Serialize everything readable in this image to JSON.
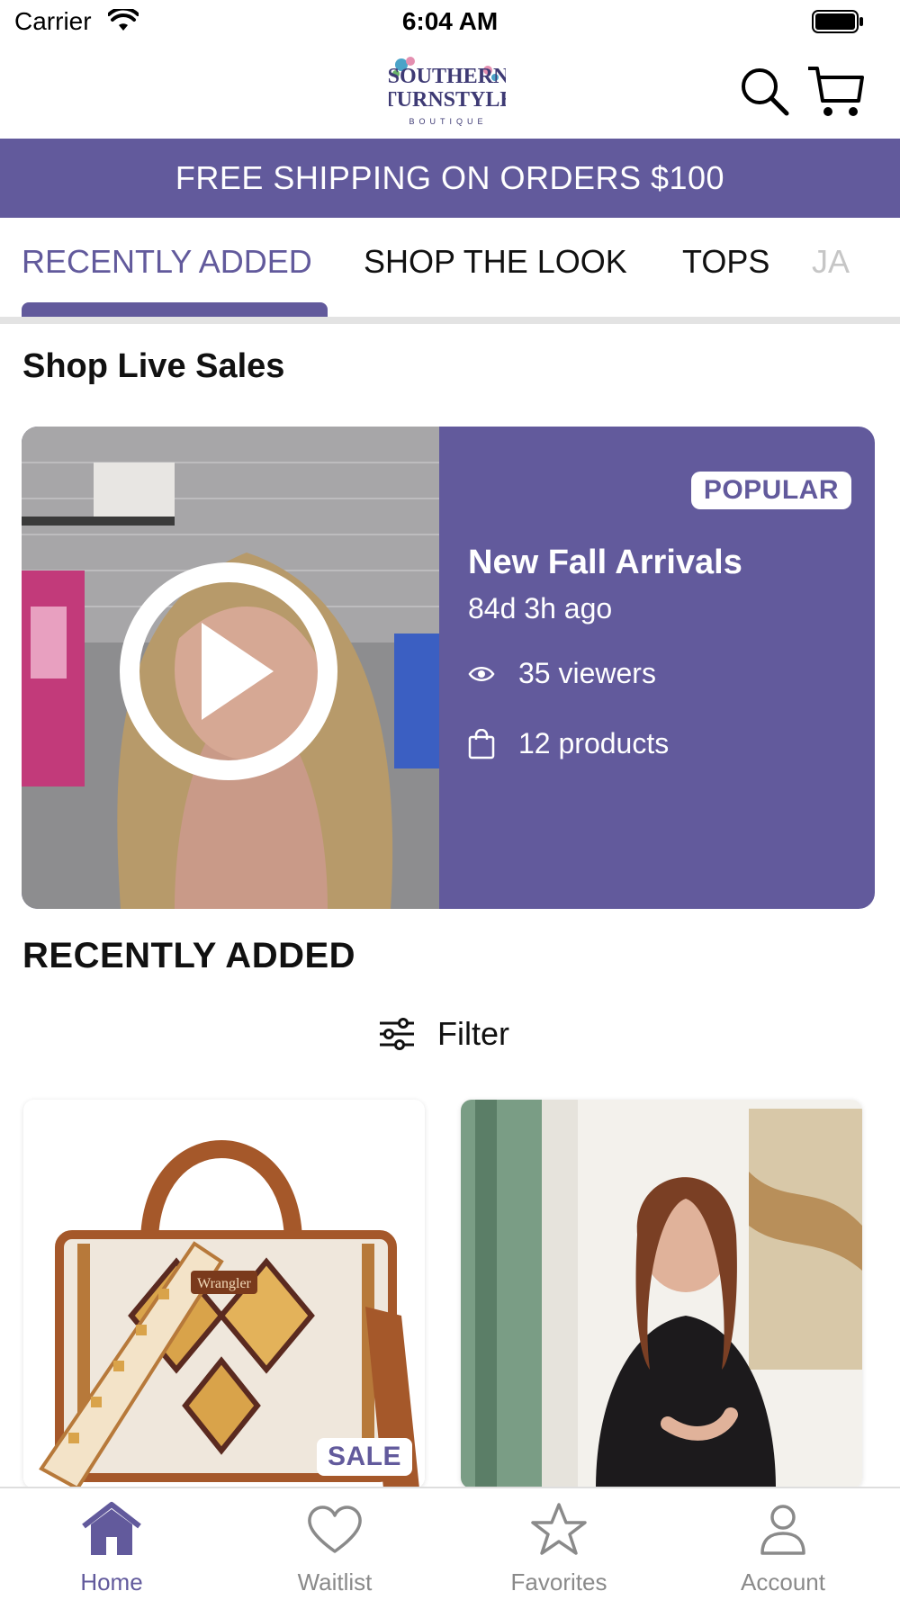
{
  "status_bar": {
    "carrier": "Carrier",
    "time": "6:04 AM"
  },
  "header": {
    "logo_line1": "SOUTHERN",
    "logo_line2": "TURNSTYLE",
    "logo_line3": "BOUTIQUE",
    "icons": [
      "search-icon",
      "cart-icon"
    ]
  },
  "promo": {
    "text": "FREE SHIPPING ON ORDERS $100"
  },
  "tabs": [
    {
      "label": "RECENTLY ADDED",
      "active": true
    },
    {
      "label": "SHOP THE LOOK",
      "active": false
    },
    {
      "label": "TOPS",
      "active": false
    },
    {
      "label": "JA",
      "active": false
    }
  ],
  "live": {
    "section_title": "Shop Live Sales",
    "badge": "POPULAR",
    "title": "New Fall Arrivals",
    "ago": "84d 3h ago",
    "viewers": "35 viewers",
    "products": "12 products"
  },
  "recent": {
    "section_title": "RECENTLY ADDED",
    "filter_label": "Filter",
    "products": [
      {
        "badge": "SALE",
        "brand_text": "Wrangler"
      },
      {
        "badge": ""
      }
    ]
  },
  "bottom_nav": [
    {
      "label": "Home",
      "icon": "home-icon",
      "active": true
    },
    {
      "label": "Waitlist",
      "icon": "heart-icon",
      "active": false
    },
    {
      "label": "Favorites",
      "icon": "star-icon",
      "active": false
    },
    {
      "label": "Account",
      "icon": "person-icon",
      "active": false
    }
  ],
  "colors": {
    "brand": "#625a9c",
    "inactive": "#8a8a8a",
    "divider": "#e3e3e3"
  }
}
